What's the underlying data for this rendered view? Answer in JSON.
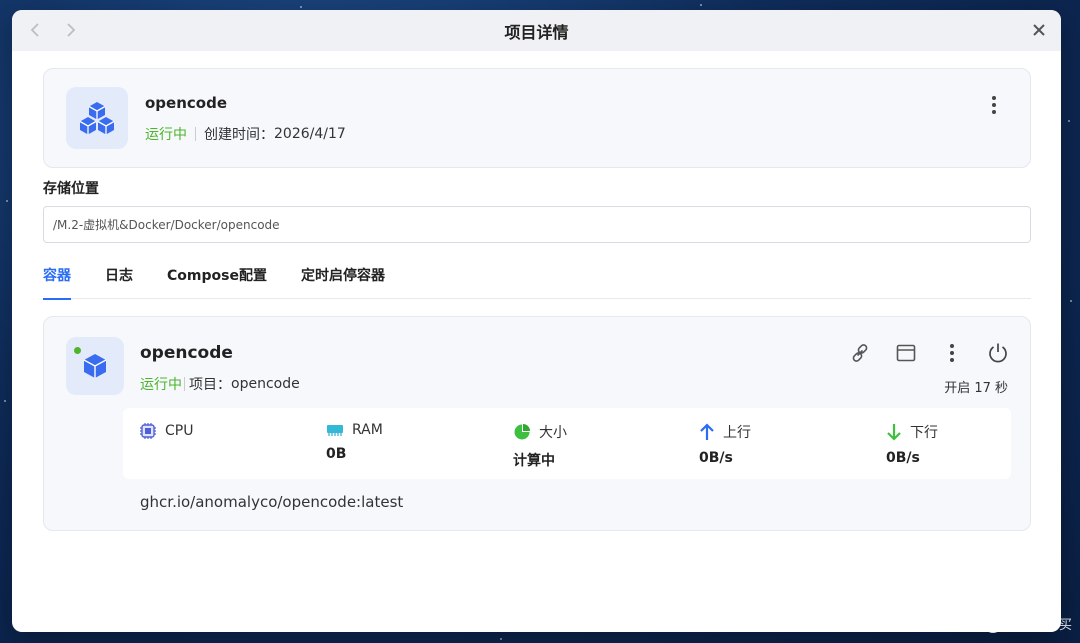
{
  "window": {
    "title": "项目详情"
  },
  "project": {
    "name": "opencode",
    "status": "运行中",
    "created_label": "创建时间：",
    "created_value": "2026/4/17"
  },
  "storage": {
    "label": "存储位置",
    "path": "/M.2-虚拟机&Docker/Docker/opencode"
  },
  "tabs": [
    {
      "label": "容器",
      "active": true
    },
    {
      "label": "日志",
      "active": false
    },
    {
      "label": "Compose配置",
      "active": false
    },
    {
      "label": "定时启停容器",
      "active": false
    }
  ],
  "container": {
    "name": "opencode",
    "status": "运行中",
    "project_label": "项目：",
    "project_value": "opencode",
    "uptime": "开启 17 秒",
    "image": "ghcr.io/anomalyco/opencode:latest",
    "stats": [
      {
        "icon": "cpu-icon",
        "label": "CPU",
        "value": ""
      },
      {
        "icon": "ram-icon",
        "label": "RAM",
        "value": "0B"
      },
      {
        "icon": "pie-chart-icon",
        "label": "大小",
        "value": "计算中"
      },
      {
        "icon": "arrow-up-icon",
        "label": "上行",
        "value": "0B/s"
      },
      {
        "icon": "arrow-down-icon",
        "label": "下行",
        "value": "0B/s"
      }
    ]
  },
  "watermark": {
    "badge": "值",
    "text": "什么值得买"
  },
  "colors": {
    "accent": "#2a6df4",
    "running": "#4cb52b",
    "download": "#4cb52b",
    "upload": "#2a6df4"
  }
}
